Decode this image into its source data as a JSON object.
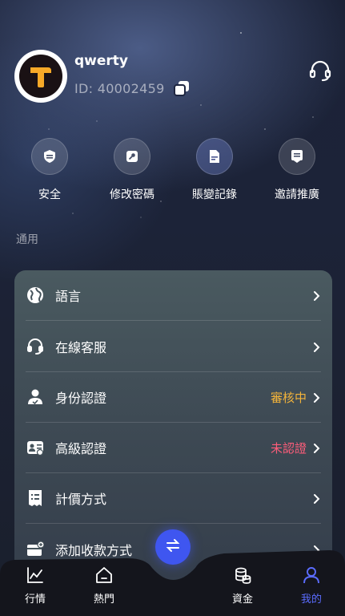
{
  "profile": {
    "username": "qwerty",
    "uid_text": "ID: 40002459"
  },
  "quick_actions": [
    {
      "label": "安全",
      "icon": "shield-icon"
    },
    {
      "label": "修改密碼",
      "icon": "key-icon"
    },
    {
      "label": "賬變記錄",
      "icon": "document-icon"
    },
    {
      "label": "邀請推廣",
      "icon": "invite-icon"
    }
  ],
  "section_title": "通用",
  "menu": [
    {
      "label": "語言",
      "icon": "globe-icon",
      "status": ""
    },
    {
      "label": "在線客服",
      "icon": "headset-icon",
      "status": ""
    },
    {
      "label": "身份認證",
      "icon": "user-id-icon",
      "status": "審核中",
      "status_color": "#f2b33a"
    },
    {
      "label": "高級認證",
      "icon": "id-card-icon",
      "status": "未認證",
      "status_color": "#ff5d7a"
    },
    {
      "label": "計價方式",
      "icon": "receipt-icon",
      "status": ""
    },
    {
      "label": "添加收款方式",
      "icon": "card-add-icon",
      "status": ""
    }
  ],
  "nav": {
    "items": [
      {
        "label": "行情",
        "icon": "chart-icon"
      },
      {
        "label": "熱門",
        "icon": "home-icon"
      },
      {
        "label": "資金",
        "icon": "coins-icon"
      },
      {
        "label": "我的",
        "icon": "user-icon",
        "active": true
      }
    ],
    "fab_icon": "exchange-icon"
  },
  "colors": {
    "accent": "#5b6cff",
    "fab": "#3f56f0",
    "pending": "#f2b33a",
    "unverified": "#ff5d7a",
    "logo_orange": "#f7a928"
  }
}
